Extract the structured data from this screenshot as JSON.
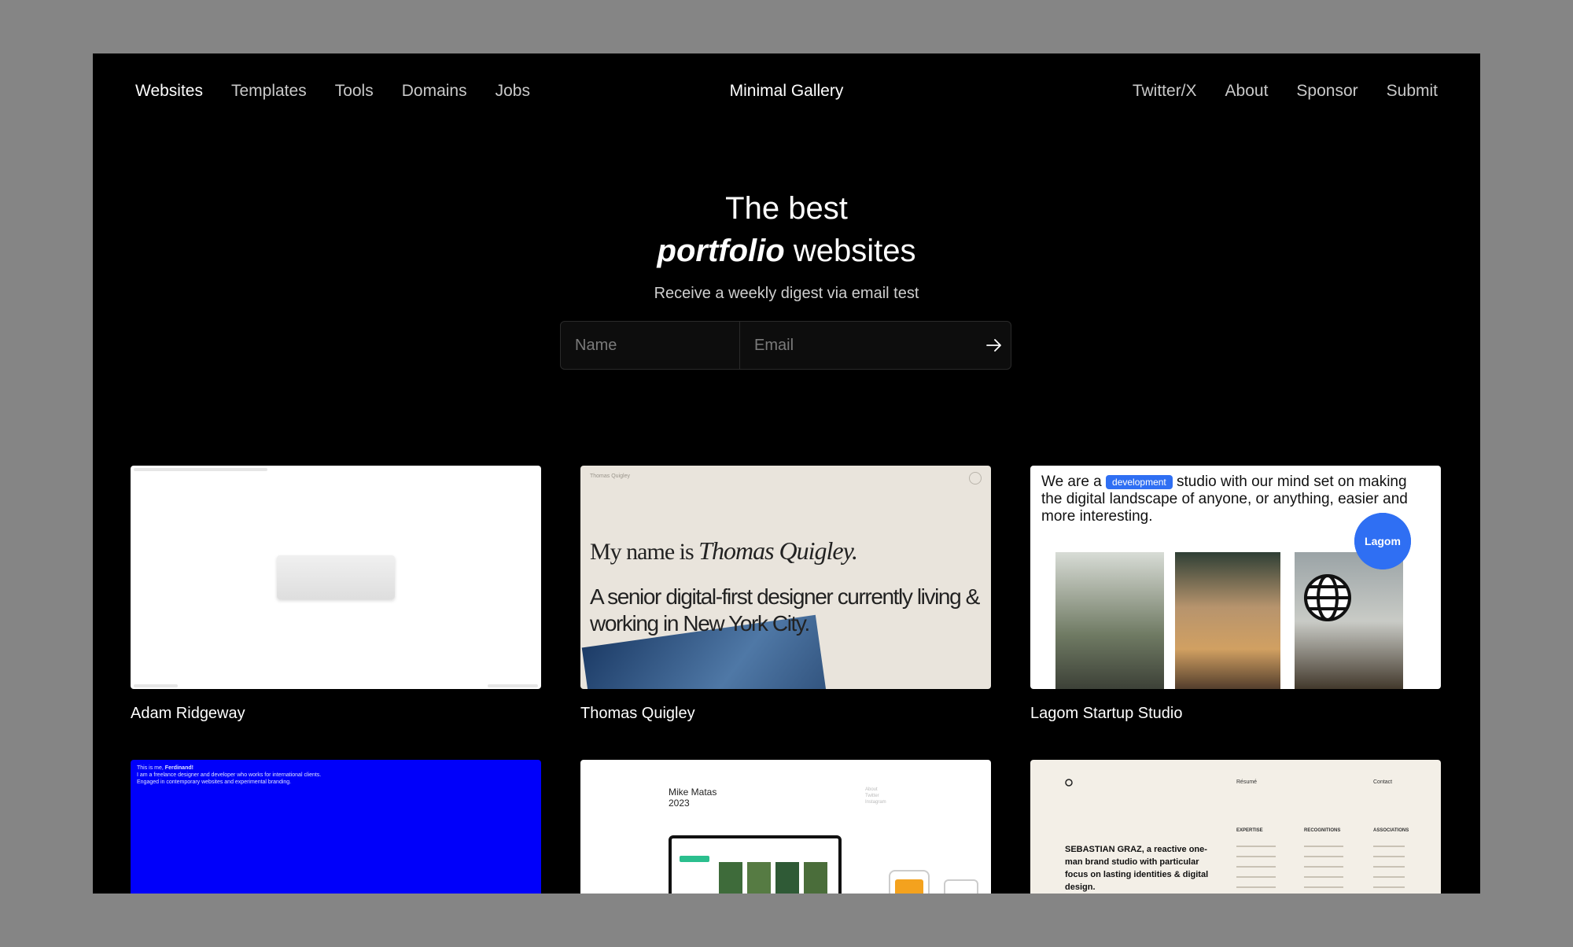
{
  "nav_left": [
    "Websites",
    "Templates",
    "Tools",
    "Domains",
    "Jobs"
  ],
  "brand": "Minimal Gallery",
  "nav_right": [
    "Twitter/X",
    "About",
    "Sponsor",
    "Submit"
  ],
  "hero": {
    "line1": "The best",
    "line2_em": "portfolio",
    "line2_rest": " websites",
    "subtitle": "Receive a weekly digest via email test"
  },
  "form": {
    "name_placeholder": "Name",
    "email_placeholder": "Email"
  },
  "cards": [
    {
      "title": "Adam Ridgeway"
    },
    {
      "title": "Thomas Quigley",
      "thumb_small": "Thomas Quigley",
      "thumb_l1": "My name is ",
      "thumb_l1_em": "Thomas Quigley.",
      "thumb_l2": "A senior digital-first designer currently living & working in New York City."
    },
    {
      "title": "Lagom Startup Studio",
      "thumb_pre": "We are a ",
      "thumb_tag": "development",
      "thumb_post": " studio with our mind set on making the digital landscape of anyone, or anything, easier and more interesting.",
      "thumb_badge": "Lagom"
    },
    {
      "thumb_line1_pre": "This is me, ",
      "thumb_line1_bold": "Ferdinand!",
      "thumb_line2": "I am a freelance designer and developer who works for international clients.",
      "thumb_line3": "Engaged in contemporary websites and experimental branding."
    },
    {
      "thumb_name": "Mike Matas",
      "thumb_year": "2023",
      "thumb_links": [
        "About",
        "Twitter",
        "Instagram"
      ]
    },
    {
      "thumb_nav": [
        "Résumé",
        "Contact"
      ],
      "thumb_text": "SEBASTIAN GRAZ, a reactive one-man brand studio with particular focus on lasting identities & digital design.",
      "thumb_cols": [
        "EXPERTISE",
        "RECOGNITIONS",
        "ASSOCIATIONS"
      ]
    }
  ],
  "colors": {
    "accent_blue": "#2f6ff3",
    "bright_blue": "#0000fa",
    "page_bg": "#000000"
  }
}
